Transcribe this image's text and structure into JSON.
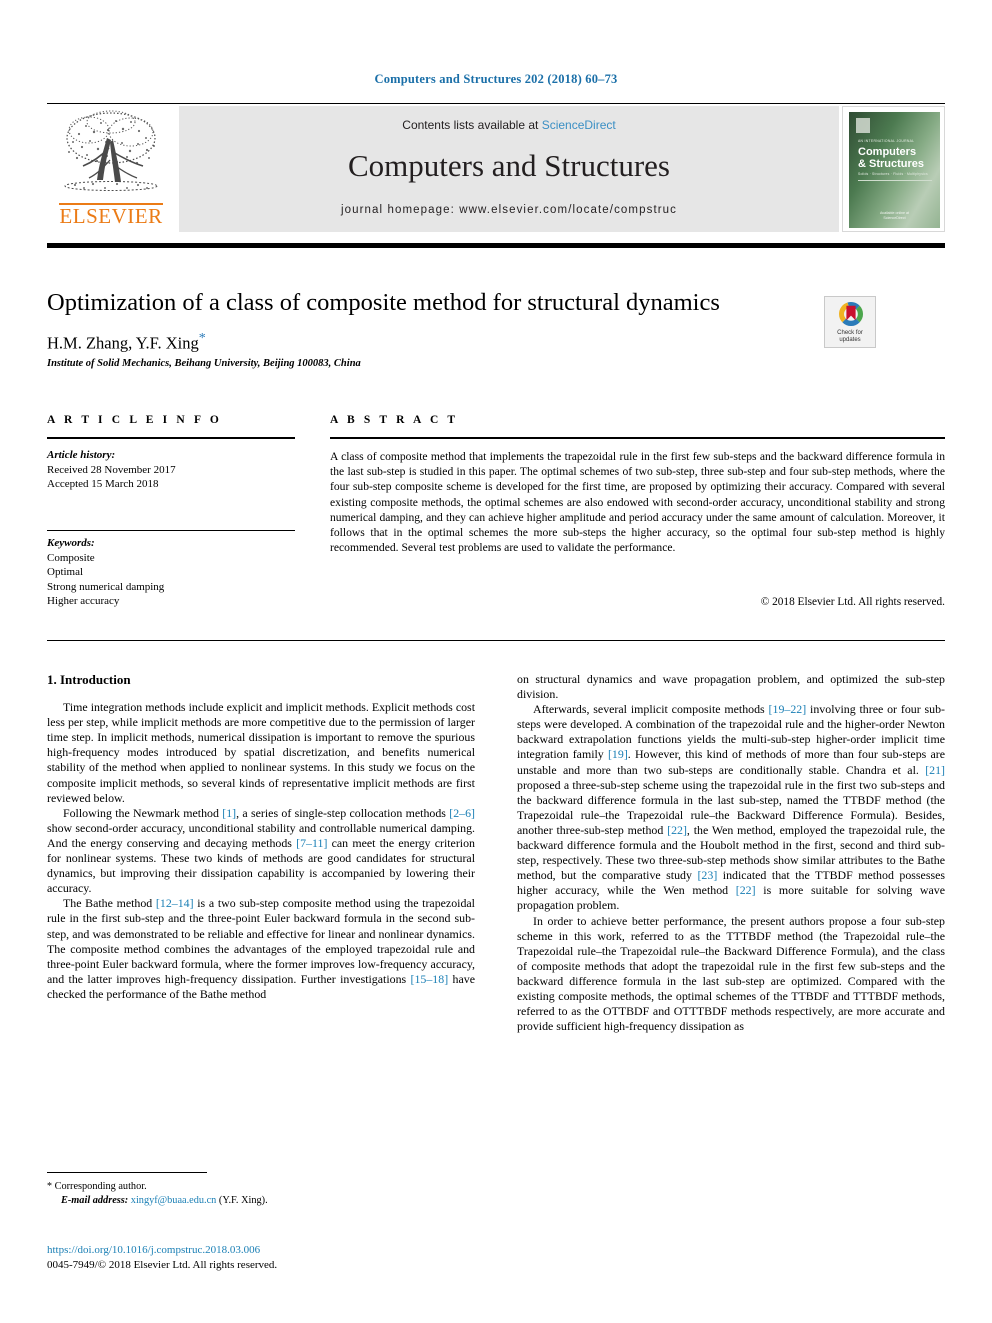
{
  "running_head": "Computers and Structures 202 (2018) 60–73",
  "masthead": {
    "publisher_name": "ELSEVIER",
    "contents_prefix": "Contents lists available at ",
    "sciencedirect": "ScienceDirect",
    "journal_name": "Computers and Structures",
    "homepage": "journal homepage: www.elsevier.com/locate/compstruc",
    "cover": {
      "kicker": "AN INTERNATIONAL JOURNAL",
      "title_line1": "Computers",
      "title_line2": "& Structures",
      "subtitle": "Solids · Structures · Fluids · Multiphysics",
      "footer_line1": "Available online at",
      "footer_line2": "ScienceDirect"
    }
  },
  "article": {
    "title": "Optimization of a class of composite method for structural dynamics",
    "authors": "H.M. Zhang, Y.F. Xing",
    "corresponding_marker": "*",
    "affiliation": "Institute of Solid Mechanics, Beihang University, Beijing 100083, China"
  },
  "crossmark": {
    "label_line1": "Check for",
    "label_line2": "updates",
    "ring_colors": [
      "#f0b323",
      "#2b7bb9",
      "#4ca64c"
    ],
    "bookmark_color": "#c8102e"
  },
  "article_info": {
    "heading": "A R T I C L E  I N F O",
    "history_label": "Article history:",
    "received": "Received 28 November 2017",
    "accepted": "Accepted 15 March 2018",
    "keywords_label": "Keywords:",
    "keywords": [
      "Composite",
      "Optimal",
      "Strong numerical damping",
      "Higher accuracy"
    ]
  },
  "abstract": {
    "heading": "A B S T R A C T",
    "text": "A class of composite method that implements the trapezoidal rule in the first few sub-steps and the backward difference formula in the last sub-step is studied in this paper. The optimal schemes of two sub-step, three sub-step and four sub-step methods, where the four sub-step composite scheme is developed for the first time, are proposed by optimizing their accuracy. Compared with several existing composite methods, the optimal schemes are also endowed with second-order accuracy, unconditional stability and strong numerical damping, and they can achieve higher amplitude and period accuracy under the same amount of calculation. Moreover, it follows that in the optimal schemes the more sub-steps the higher accuracy, so the optimal four sub-step method is highly recommended. Several test problems are used to validate the performance.",
    "copyright": "© 2018 Elsevier Ltd. All rights reserved."
  },
  "body": {
    "section_heading": "1. Introduction",
    "left_paragraphs": [
      "Time integration methods include explicit and implicit methods. Explicit methods cost less per step, while implicit methods are more competitive due to the permission of larger time step. In implicit methods, numerical dissipation is important to remove the spurious high-frequency modes introduced by spatial discretization, and benefits numerical stability of the method when applied to nonlinear systems. In this study we focus on the composite implicit methods, so several kinds of representative implicit methods are first reviewed below.",
      "Following the Newmark method [1], a series of single-step collocation methods [2–6] show second-order accuracy, unconditional stability and controllable numerical damping. And the energy conserving and decaying methods [7–11] can meet the energy criterion for nonlinear systems. These two kinds of methods are good candidates for structural dynamics, but improving their dissipation capability is accompanied by lowering their accuracy.",
      "The Bathe method [12–14] is a two sub-step composite method using the trapezoidal rule in the first sub-step and the three-point Euler backward formula in the second sub-step, and was demonstrated to be reliable and effective for linear and nonlinear dynamics. The composite method combines the advantages of the employed trapezoidal rule and three-point Euler backward formula, where the former improves low-frequency accuracy, and the latter improves high-frequency dissipation. Further investigations [15–18] have checked the performance of the Bathe method"
    ],
    "right_paragraphs": [
      "on structural dynamics and wave propagation problem, and optimized the sub-step division.",
      "Afterwards, several implicit composite methods [19–22] involving three or four sub-steps were developed. A combination of the trapezoidal rule and the higher-order Newton backward extrapolation functions yields the multi-sub-step higher-order implicit time integration family [19]. However, this kind of methods of more than four sub-steps are unstable and more than two sub-steps are conditionally stable. Chandra et al. [21] proposed a three-sub-step scheme using the trapezoidal rule in the first two sub-steps and the backward difference formula in the last sub-step, named the TTBDF method (the Trapezoidal rule–the Trapezoidal rule–the Backward Difference Formula). Besides, another three-sub-step method [22], the Wen method, employed the trapezoidal rule, the backward difference formula and the Houbolt method in the first, second and third sub-step, respectively. These two three-sub-step methods show similar attributes to the Bathe method, but the comparative study [23] indicated that the TTBDF method possesses higher accuracy, while the Wen method [22] is more suitable for solving wave propagation problem.",
      "In order to achieve better performance, the present authors propose a four sub-step scheme in this work, referred to as the TTTBDF method (the Trapezoidal rule–the Trapezoidal rule–the Trapezoidal rule–the Backward Difference Formula), and the class of composite methods that adopt the trapezoidal rule in the first few sub-steps and the backward difference formula in the last sub-step are optimized. Compared with the existing composite methods, the optimal schemes of the TTBDF and TTTBDF methods, referred to as the OTTBDF and OTTTBDF methods respectively, are more accurate and provide sufficient high-frequency dissipation as"
    ]
  },
  "footer": {
    "corresponding_marker": "*",
    "corresponding_text": "Corresponding author.",
    "email_label": "E-mail address:",
    "email": "xingyf@buaa.edu.cn",
    "email_owner": "(Y.F. Xing).",
    "doi": "https://doi.org/10.1016/j.compstruc.2018.03.006",
    "issn_line": "0045-7949/© 2018 Elsevier Ltd. All rights reserved."
  },
  "colors": {
    "link_blue": "#1a7fb5",
    "header_blue": "#1a6fa8",
    "elsevier_orange": "#eb7b16",
    "masthead_gray": "#e6e6e6"
  }
}
